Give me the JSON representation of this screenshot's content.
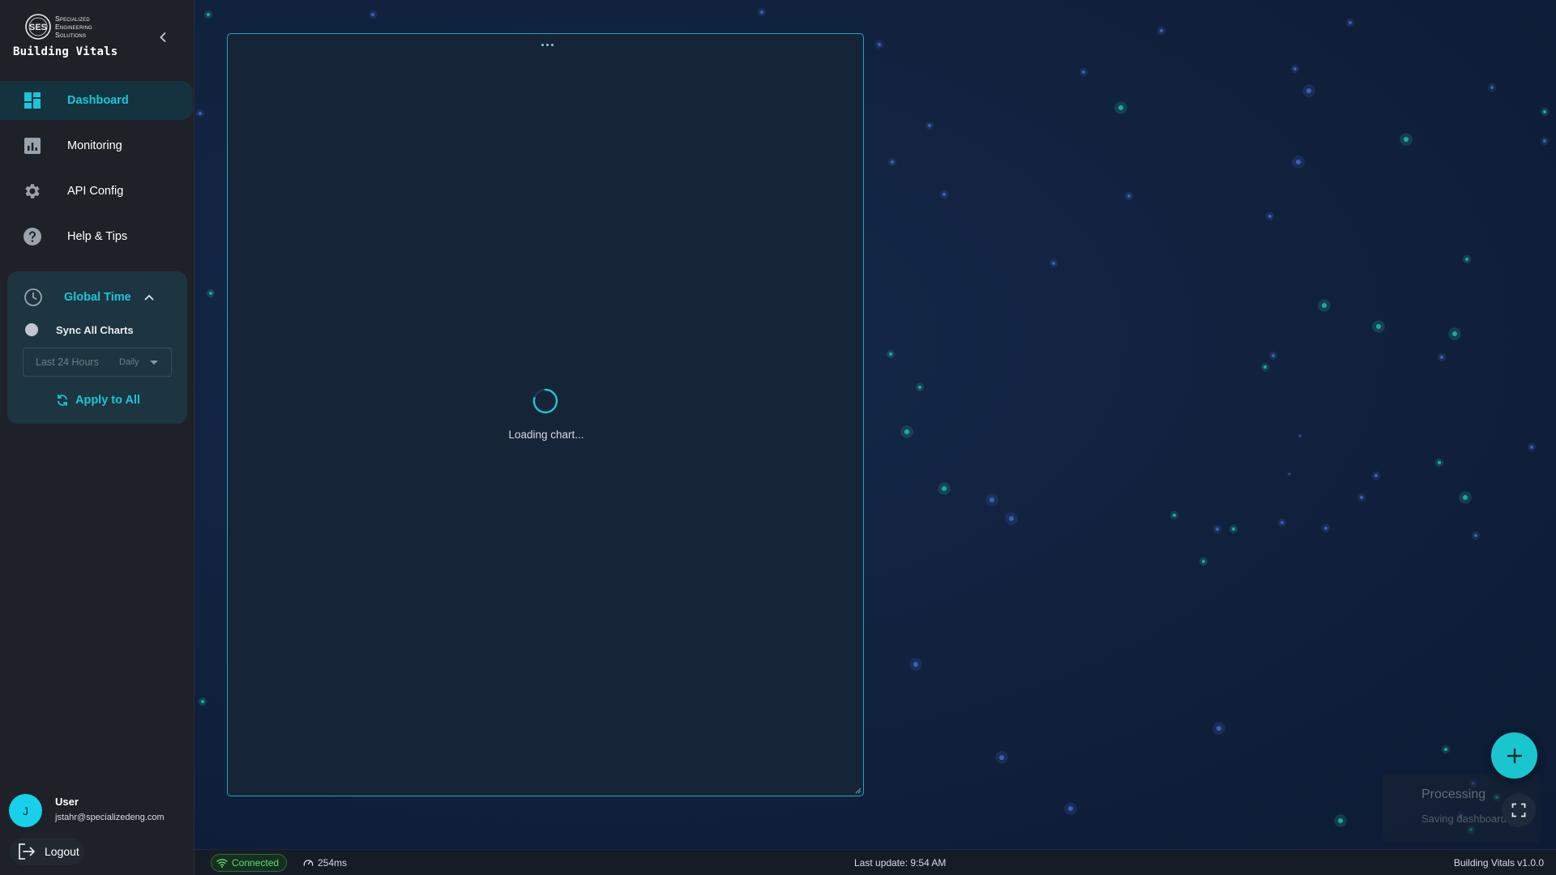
{
  "brand": {
    "company_line1": "Specialized",
    "company_line2": "Engineering",
    "company_line3": "Solutions",
    "logo_text": "SES",
    "app_name": "Building Vitals"
  },
  "sidebar": {
    "items": [
      {
        "label": "Dashboard",
        "icon": "dashboard-icon",
        "active": true
      },
      {
        "label": "Monitoring",
        "icon": "bar-chart-icon",
        "active": false
      },
      {
        "label": "API Config",
        "icon": "gear-icon",
        "active": false
      },
      {
        "label": "Help & Tips",
        "icon": "help-circle-icon",
        "active": false
      }
    ]
  },
  "global_time": {
    "title": "Global Time",
    "sync_label": "Sync All Charts",
    "sync_enabled": false,
    "range_value": "Last 24 Hours",
    "interval_value": "Daily",
    "apply_label": "Apply to All"
  },
  "user": {
    "initial": "J",
    "name": "User",
    "email": "jstahr@specializedeng.com",
    "logout_label": "Logout"
  },
  "chart_card": {
    "loading_text": "Loading chart..."
  },
  "toast": {
    "title": "Processing",
    "subtitle": "Saving dashboard..."
  },
  "status_bar": {
    "connection": "Connected",
    "latency": "254ms",
    "last_update": "Last update: 9:54 AM",
    "version": "Building Vitals v1.0.0"
  },
  "colors": {
    "accent": "#19c6d8",
    "sidebar_bg": "#1e2127",
    "canvas_bg": "#10213d",
    "connected": "#5fdb77"
  }
}
